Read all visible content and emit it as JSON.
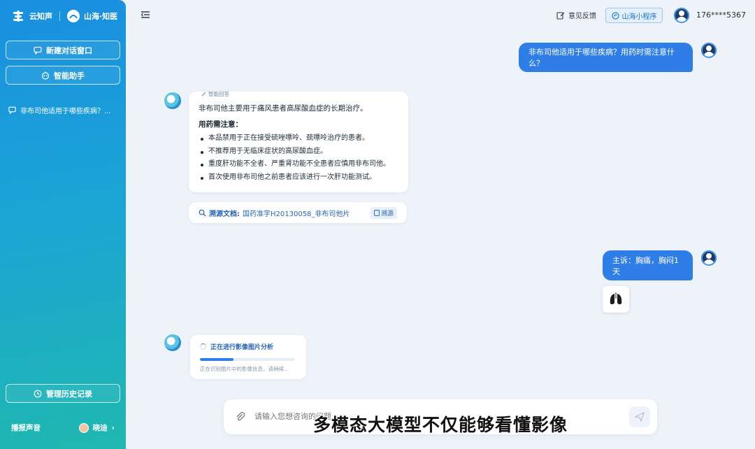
{
  "sidebar": {
    "brand_primary": "云知声",
    "brand_secondary": "山海·知医",
    "new_chat_label": "新建对话窗口",
    "assistant_label": "智能助手",
    "history_items": [
      "非布司他适用于哪些疾病？..."
    ],
    "manage_history_label": "管理历史记录",
    "footer_left": "播报声音",
    "footer_user": "晓迪",
    "colors": {
      "top": "#1a8fe0",
      "bottom": "#1fb8b0"
    }
  },
  "header": {
    "feedback_label": "意见反馈",
    "mini_program_label": "山海小程序",
    "phone": "176****5367"
  },
  "chat": {
    "user_question": "非布司他适用于哪些疾病？用药时需注意什么？",
    "answer_tag": "智能回答",
    "answer_intro": "非布司他主要用于痛风患者高尿酸血症的长期治疗。",
    "answer_heading": "用药需注意：",
    "answer_points": [
      "本品禁用于正在接受硫唑嘌呤、巯嘌呤治疗的患者。",
      "不推荐用于无临床症状的高尿酸血症。",
      "重度肝功能不全者、严重肾功能不全患者应慎用非布司他。",
      "首次使用非布司他之前患者应该进行一次肝功能测试。"
    ],
    "source_label": "溯源文档:",
    "source_doc": "国药准字H20130058_非布司他片",
    "trace_label": "溯源",
    "user_symptom": "主诉：胸痛，胸闷1天",
    "processing_title": "正在进行影像图片分析",
    "processing_progress": 0.35,
    "processing_sub": "正在识别图片中的影像信息，请稍候..."
  },
  "input": {
    "placeholder": "请输入您想咨询的问题..."
  },
  "subtitle": "多模态大模型不仅能够看懂影像",
  "accent": "#2f7ee8"
}
